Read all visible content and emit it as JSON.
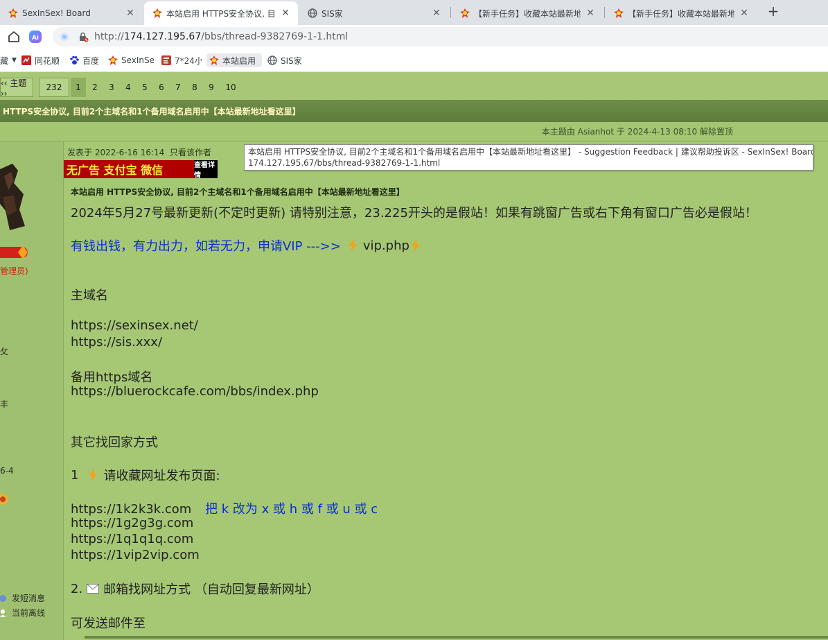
{
  "tabs": [
    {
      "title": "SexInSex! Board",
      "icon": "sis-favicon",
      "active": false
    },
    {
      "title": "本站启用 HTTPS安全协议, 目前",
      "icon": "sis-favicon",
      "active": true
    },
    {
      "title": "SIS家",
      "icon": "globe-icon",
      "active": false
    },
    {
      "title": "【新手任务】收藏本站最新地址",
      "icon": "sis-favicon",
      "active": false
    },
    {
      "title": "【新手任务】收藏本站最新地址",
      "icon": "sis-favicon",
      "active": false
    }
  ],
  "toolbar": {
    "url_scheme": "http://",
    "url_host": "174.127.195.67",
    "url_path": "/bbs/thread-9382769-1-1.html"
  },
  "bookmarks": [
    {
      "label": "藏",
      "icon": "",
      "dropdown": true
    },
    {
      "label": "同花顺",
      "icon": "tonghuashun-icon"
    },
    {
      "label": "百度",
      "icon": "baidu-paw-icon"
    },
    {
      "label": "SexInSe",
      "icon": "sis-favicon"
    },
    {
      "label": "7*24小",
      "icon": "news-icon"
    },
    {
      "label": "本站启用",
      "icon": "sis-favicon",
      "active": true
    },
    {
      "label": "SIS家",
      "icon": "globe-icon"
    }
  ],
  "tooltip": {
    "line1": "本站启用 HTTPS安全协议, 目前2个主域名和1个备用域名启用中【本站最新地址看这里】 - Suggestion Feedback | 建议帮助投诉区 - SexInSex! Board",
    "line2": "174.127.195.67/bbs/thread-9382769-1-1.html"
  },
  "pager": {
    "prev": "‹‹ 主题 ››",
    "total": "232",
    "pages": [
      "1",
      "2",
      "3",
      "4",
      "5",
      "6",
      "7",
      "8",
      "9",
      "10"
    ],
    "current": "1"
  },
  "thread_title": "HTTPS安全协议, 目前2个主域名和1个备用域名启用中【本站最新地址看这里】",
  "mod_note": "本主题由 Asianhot 于 2024-4-13 08:10 解除置顶",
  "sidebar": {
    "role": "管理员)",
    "row1": "攵",
    "row2": "丰",
    "date": "6-4",
    "send_message": "发短消息",
    "status": "当前离线"
  },
  "post": {
    "meta_prefix": "发表于 2022-6-16 16:14",
    "only_author": "只看该作者",
    "banner_text": "无广告 支付宝 微信",
    "banner_sub": "查看详情",
    "title": "本站启用 HTTPS安全协议, 目前2个主域名和1个备用域名启用中【本站最新地址看这里】",
    "update_notice": "2024年5月27号最新更新(不定时更新) 请特别注意，23.225开头的是假站！如果有跳窗广告或右下角有窗口广告必是假站！",
    "vip_line": "有钱出钱，有力出力，如若无力，申请VIP --->>",
    "vip_link": "vip.php",
    "main_domain_label": "主域名",
    "domain1": "https://sexinsex.net/",
    "domain2": "https://sis.xxx/",
    "backup_label": "备用https域名",
    "backup_domain": "https://bluerockcafe.com/bbs/index.php",
    "other_label": "其它找回家方式",
    "step1_num": "1",
    "step1_text": "请收藏网址发布页面:",
    "site1": "https://1k2k3k.com",
    "site1_hint": "把 k 改为 x 或 h 或 f 或 u 或 c",
    "site2": "https://1g2g3g.com",
    "site3": "https://1q1q1q.com",
    "site4": "https://1vip2vip.com",
    "step2_num": "2.",
    "step2_text": "邮箱找网址方式 （自动回复最新网址）",
    "mail_label": "可发送邮件至"
  }
}
